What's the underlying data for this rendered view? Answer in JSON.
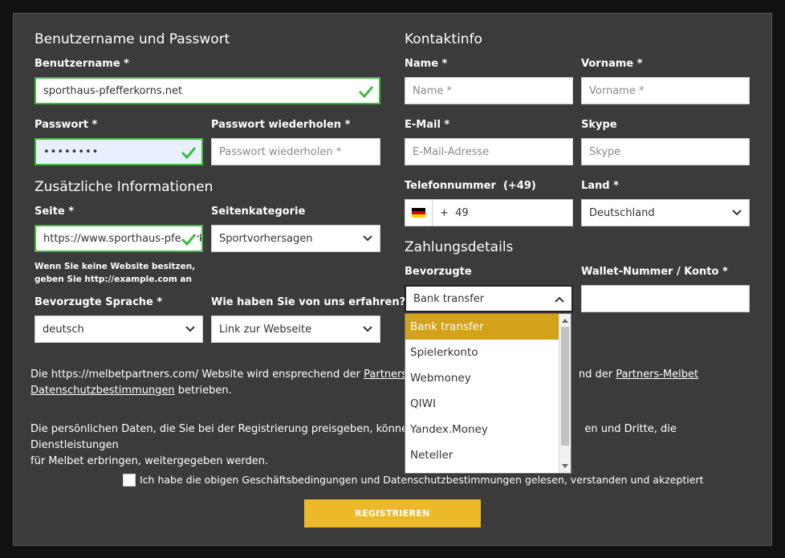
{
  "account": {
    "heading": "Benutzername und Passwort",
    "username_label": "Benutzername *",
    "username_value": "sporthaus-pfefferkorns.net",
    "password_label": "Passwort *",
    "password_value": "••••••••",
    "password_repeat_label": "Passwort wiederholen *",
    "password_repeat_placeholder": "Passwort wiederholen *"
  },
  "additional": {
    "heading": "Zusätzliche Informationen",
    "site_label": "Seite *",
    "site_value": "https://www.sporthaus-pfefferkorns.net",
    "site_category_label": "Seitenkategorie",
    "site_category_value": "Sportvorhersagen",
    "note_line1": "Wenn Sie keine Website besitzen,",
    "note_line2": "geben Sie http://example.com an",
    "language_label": "Bevorzugte Sprache *",
    "language_value": "deutsch",
    "source_label": "Wie haben Sie von uns erfahren?",
    "source_value": "Link zur Webseite"
  },
  "contact": {
    "heading": "Kontaktinfo",
    "name_label": "Name *",
    "name_placeholder": "Name *",
    "firstname_label": "Vorname *",
    "firstname_placeholder": "Vorname *",
    "email_label": "E-Mail *",
    "email_placeholder": "E-Mail-Adresse",
    "skype_label": "Skype",
    "skype_placeholder": "Skype",
    "phone_label": "Telefonnummer",
    "phone_code": "(+49)",
    "phone_value": "+  49",
    "country_label": "Land *",
    "country_value": "Deutschland"
  },
  "payment": {
    "heading": "Zahlungsdetails",
    "method_label": "Bevorzugte",
    "method_value": "Bank transfer",
    "wallet_label": "Wallet-Nummer / Konto *",
    "options": [
      "Bank transfer",
      "Spielerkonto",
      "Webmoney",
      "QIWI",
      "Yandex.Money",
      "Neteller"
    ]
  },
  "legal": {
    "p1_a": "Die https://melbetpartners.com/ Website wird ensprechend der ",
    "p1_link1": "Partners-",
    "p1_b": "nd der ",
    "p1_link2": "Partners-Melbet",
    "p1_link3": "Datenschutzbestimmungen",
    "p1_c": " betrieben.",
    "p2_a": "Die persönlichen Daten, die Sie bei der Registrierung preisgeben, können",
    "p2_b": "en und Dritte, die Dienstleistungen",
    "p2_c": "für Melbet erbringen, weitergegeben werden.",
    "terms_label": "Ich habe die obigen Geschäftsbedingungen und Datenschutzbestimmungen gelesen, verstanden und akzeptiert"
  },
  "submit_label": "REGISTRIEREN",
  "colors": {
    "valid": "#3dbb3d",
    "accent": "#ecb92b",
    "selected_option": "#d4a21a"
  }
}
